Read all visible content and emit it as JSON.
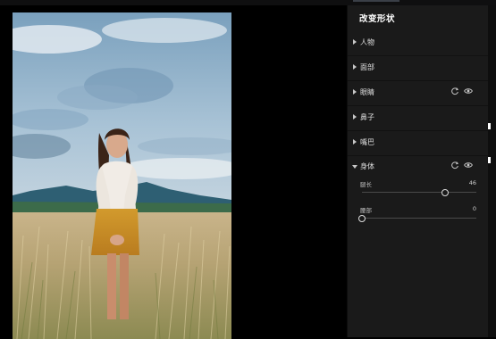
{
  "panel": {
    "title": "改变形状",
    "sections": [
      {
        "label": "人物"
      },
      {
        "label": "面部"
      },
      {
        "label": "眼睛"
      },
      {
        "label": "鼻子"
      },
      {
        "label": "嘴巴"
      },
      {
        "label": "身体"
      }
    ],
    "body_sliders": [
      {
        "label": "腿长",
        "value": "46",
        "fraction": 0.73
      },
      {
        "label": "腰部",
        "value": "0",
        "fraction": 0.0
      }
    ]
  },
  "colors": {
    "panel_bg": "#1a1a1a",
    "accent_text": "#ffffff",
    "slider_track": "#4a4a4a"
  }
}
